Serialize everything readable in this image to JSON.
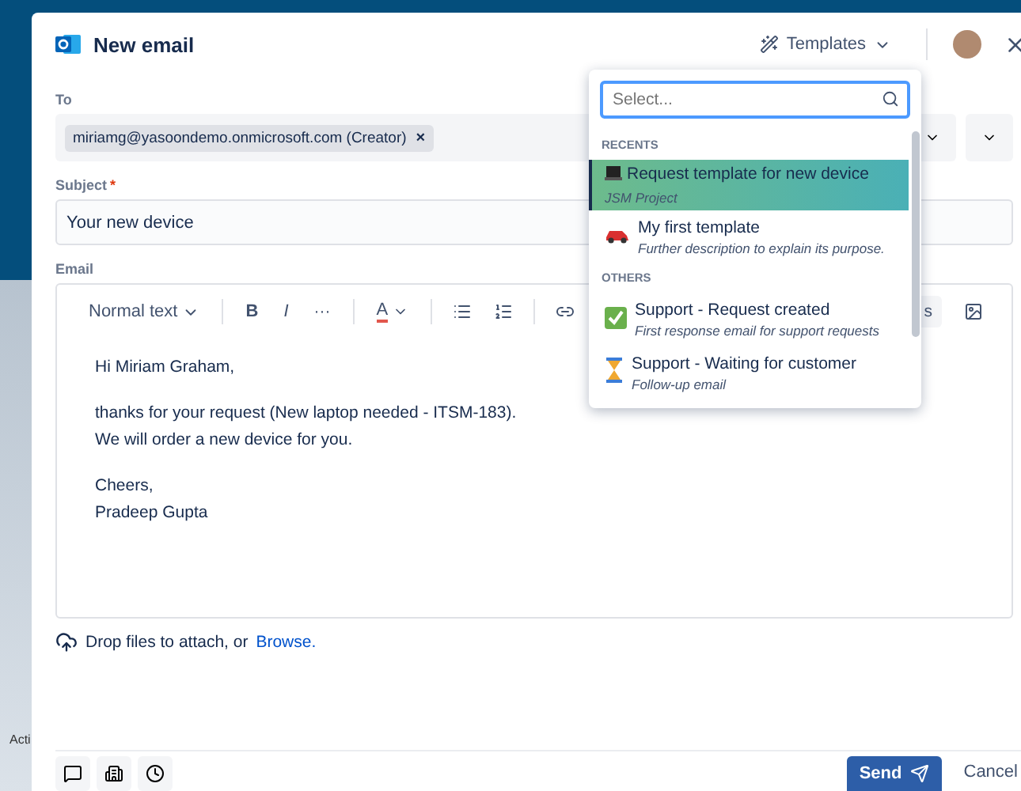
{
  "background": {
    "label": "Acti"
  },
  "header": {
    "title": "New email",
    "templates_button": "Templates"
  },
  "to": {
    "label": "To",
    "recipients": [
      {
        "text": "miriamg@yasoondemo.onmicrosoft.com (Creator)",
        "remove": "×"
      }
    ]
  },
  "subject": {
    "label": "Subject",
    "required_mark": "*",
    "value": "Your new device"
  },
  "email": {
    "label": "Email",
    "toolbar": {
      "text_style": "Normal text",
      "bold": "B",
      "italic": "I",
      "more": "···",
      "font_color_button": "A",
      "partial_button": "s"
    },
    "body": [
      [
        "Hi Miriam Graham,"
      ],
      [
        "thanks for your request (New laptop needed - ITSM-183).",
        "We will order a new device for you."
      ],
      [
        "Cheers,",
        "Pradeep Gupta"
      ]
    ]
  },
  "attach": {
    "text": "Drop files to attach, or",
    "link": "Browse."
  },
  "footer": {
    "send": "Send",
    "cancel": "Cancel"
  },
  "template_picker": {
    "placeholder": "Select...",
    "groups": [
      {
        "heading": "RECENTS",
        "items": [
          {
            "title": "Request template for new device",
            "subtitle": "JSM Project",
            "kind": "laptop",
            "selected": true
          },
          {
            "title": "My first template",
            "subtitle": "Further description to explain its purpose.",
            "kind": "car",
            "selected": false
          }
        ]
      },
      {
        "heading": "OTHERS",
        "items": [
          {
            "title": "Support - Request created",
            "subtitle": "First response email for support requests",
            "kind": "check",
            "selected": false
          },
          {
            "title": "Support - Waiting for customer",
            "subtitle": "Follow-up email",
            "kind": "hourglass",
            "selected": false
          }
        ]
      }
    ]
  }
}
